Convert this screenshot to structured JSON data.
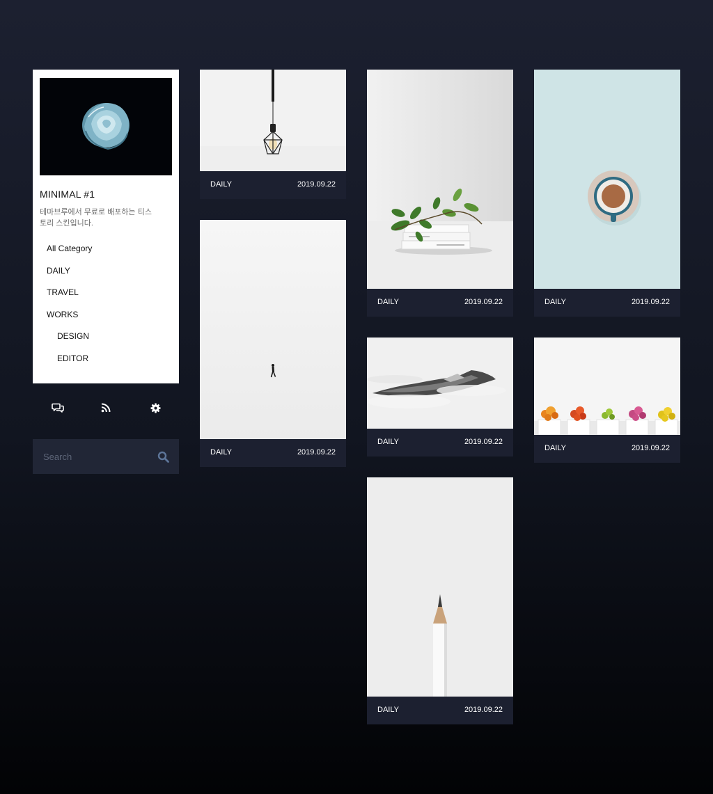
{
  "sidebar": {
    "blog_title": "MINIMAL #1",
    "blog_description": "테마브루에서 무료로 배포하는 티스토리 스킨입니다.",
    "profile_image": "blue-rose-on-black",
    "categories": [
      {
        "label": "All Category",
        "level": 0
      },
      {
        "label": "DAILY",
        "level": 0
      },
      {
        "label": "TRAVEL",
        "level": 0
      },
      {
        "label": "WORKS",
        "level": 0
      },
      {
        "label": "DESIGN",
        "level": 1
      },
      {
        "label": "EDITOR",
        "level": 1
      }
    ],
    "icons": [
      "guestbook-icon",
      "rss-icon",
      "settings-icon"
    ],
    "search": {
      "placeholder": "Search",
      "value": "",
      "icon": "search-icon"
    }
  },
  "posts": [
    {
      "category": "DAILY",
      "date": "2019.09.22",
      "image": "hanging-bulb"
    },
    {
      "category": "DAILY",
      "date": "2019.09.22",
      "image": "person-walking-snow"
    },
    {
      "category": "DAILY",
      "date": "2019.09.22",
      "image": "books-with-plant"
    },
    {
      "category": "DAILY",
      "date": "2019.09.22",
      "image": "misty-mountain"
    },
    {
      "category": "DAILY",
      "date": "2019.09.22",
      "image": "white-pencil"
    },
    {
      "category": "DAILY",
      "date": "2019.09.22",
      "image": "coffee-cup-top-view"
    },
    {
      "category": "DAILY",
      "date": "2019.09.22",
      "image": "flower-pots-row"
    }
  ],
  "colors": {
    "page_background": "#1c2030",
    "card_footer": "#1c2030",
    "search_background": "#212636",
    "accent_icon": "#5d7599"
  }
}
